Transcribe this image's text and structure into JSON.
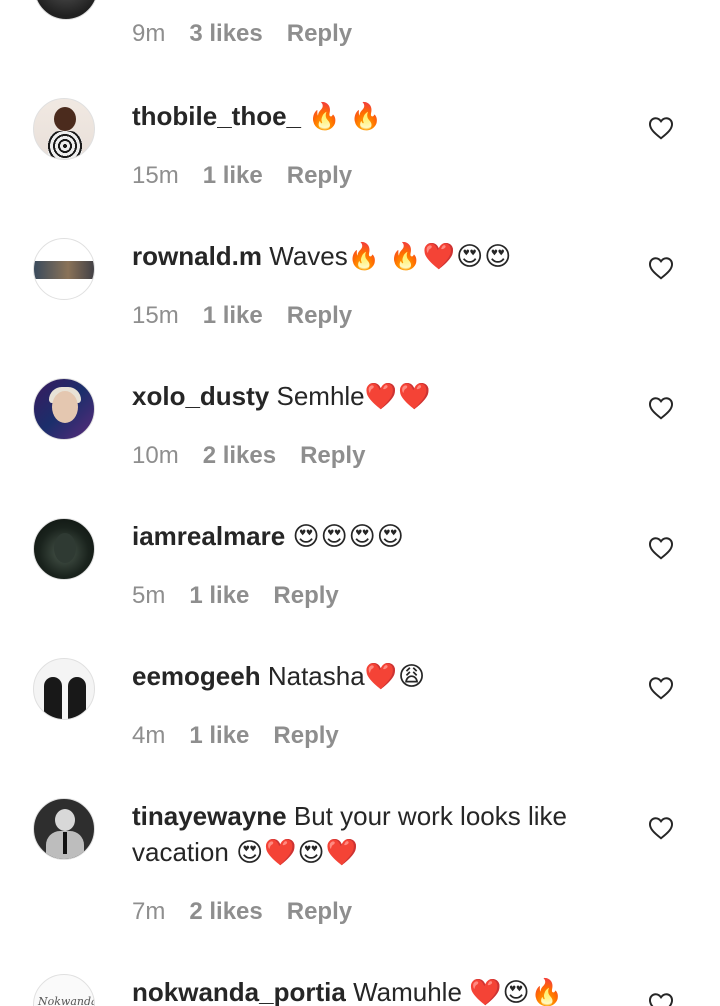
{
  "top_meta": {
    "time": "9m",
    "likes": "3 likes",
    "reply": "Reply"
  },
  "comments": [
    {
      "username": "thobile_thoe_",
      "text": "",
      "emojis": "🔥 🔥",
      "time": "15m",
      "likes": "1 like",
      "reply": "Reply"
    },
    {
      "username": "rownald.m",
      "text": "Waves",
      "emojis": "🔥 🔥❤️😍😍",
      "time": "15m",
      "likes": "1 like",
      "reply": "Reply"
    },
    {
      "username": "xolo_dusty",
      "text": "Semhle",
      "emojis": "❤️❤️",
      "time": "10m",
      "likes": "2 likes",
      "reply": "Reply"
    },
    {
      "username": "iamrealmare",
      "text": "",
      "emojis": "😍😍😍😍",
      "time": "5m",
      "likes": "1 like",
      "reply": "Reply"
    },
    {
      "username": "eemogeeh",
      "text": "Natasha",
      "emojis": "❤️😩",
      "time": "4m",
      "likes": "1 like",
      "reply": "Reply"
    },
    {
      "username": "tinayewayne",
      "text": "But your work looks like vacation",
      "emojis": "😍❤️😍❤️",
      "time": "7m",
      "likes": "2 likes",
      "reply": "Reply"
    },
    {
      "username": "nokwanda_portia",
      "text": "Wamuhle",
      "emojis": "❤️😍🔥",
      "time": "",
      "likes": "",
      "reply": ""
    }
  ],
  "avatar_7_text": "Nokwanda"
}
